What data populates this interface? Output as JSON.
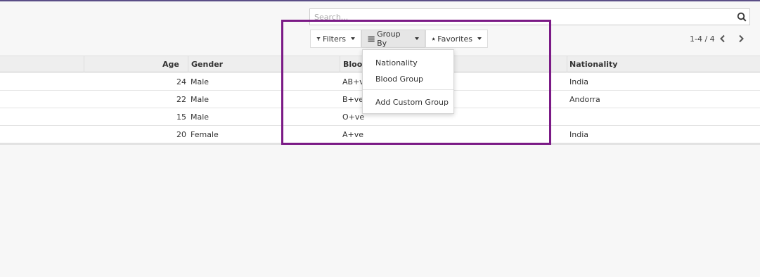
{
  "search": {
    "placeholder": "Search..."
  },
  "toolbar": {
    "filters_label": "Filters",
    "groupby_label": "Group By",
    "favorites_label": "Favorites"
  },
  "pager": {
    "text": "1-4 / 4"
  },
  "table": {
    "headers": {
      "age": "Age",
      "gender": "Gender",
      "blood": "Blood Group",
      "nationality": "Nationality"
    },
    "rows": [
      {
        "age": "24",
        "gender": "Male",
        "blood": "AB+ve",
        "nationality": "India"
      },
      {
        "age": "22",
        "gender": "Male",
        "blood": "B+ve",
        "nationality": "Andorra"
      },
      {
        "age": "15",
        "gender": "Male",
        "blood": "O+ve",
        "nationality": ""
      },
      {
        "age": "20",
        "gender": "Female",
        "blood": "A+ve",
        "nationality": "India"
      }
    ]
  },
  "groupby_menu": {
    "items": [
      "Nationality",
      "Blood Group"
    ],
    "custom": "Add Custom Group"
  },
  "colors": {
    "highlight": "#7b1a86",
    "topbar": "#5a4e86"
  }
}
